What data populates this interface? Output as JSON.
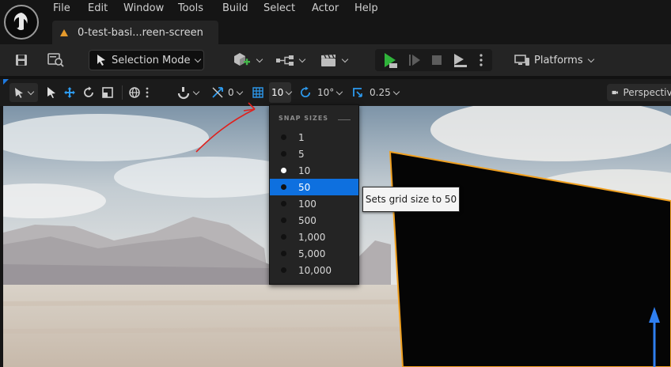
{
  "menu": {
    "items": [
      "File",
      "Edit",
      "Window",
      "Tools",
      "Build",
      "Select",
      "Actor",
      "Help"
    ]
  },
  "document_tab": {
    "title": "0-test-basi...reen-screen",
    "warning_icon": "warning-triangle-icon"
  },
  "main_toolbar": {
    "save_icon": "save-icon",
    "browse_icon": "content-browse-icon",
    "selection_mode": "Selection Mode",
    "platforms": "Platforms"
  },
  "viewport_toolbar": {
    "translate_snap_value": "0",
    "grid_snap_value": "10",
    "rotation_snap_value": "10°",
    "scale_snap_value": "0.25",
    "perspective_label": "Perspective"
  },
  "snap_dropdown": {
    "header": "SNAP SIZES",
    "options": [
      "1",
      "5",
      "10",
      "50",
      "100",
      "500",
      "1,000",
      "5,000",
      "10,000"
    ],
    "selected": "10",
    "highlighted": "50"
  },
  "tooltip": {
    "text": "Sets grid size to 50"
  },
  "colors": {
    "accent_blue": "#0e70df",
    "play_green": "#2fb33a",
    "selection_outline": "#f0a020",
    "annotation_red": "#e0201c"
  }
}
